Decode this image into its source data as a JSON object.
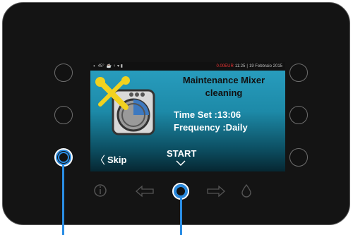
{
  "status": {
    "left_temp": "45°",
    "alert": "0.00EUR",
    "time": "11:25",
    "date": "19 Febbraio 2015"
  },
  "screen": {
    "title_line1": "Maintenance Mixer",
    "title_line2": "cleaning",
    "time_set": "Time Set :13:06",
    "frequency": "Frequency :Daily",
    "skip_label": "Skip",
    "start_label": "START"
  },
  "colors": {
    "accent": "#2a8de4",
    "screen_top": "#2aa0c2",
    "screen_bottom": "#062732"
  },
  "icons": [
    "info-icon",
    "arrow-left-icon",
    "center-button",
    "arrow-right-icon",
    "drop-icon"
  ]
}
